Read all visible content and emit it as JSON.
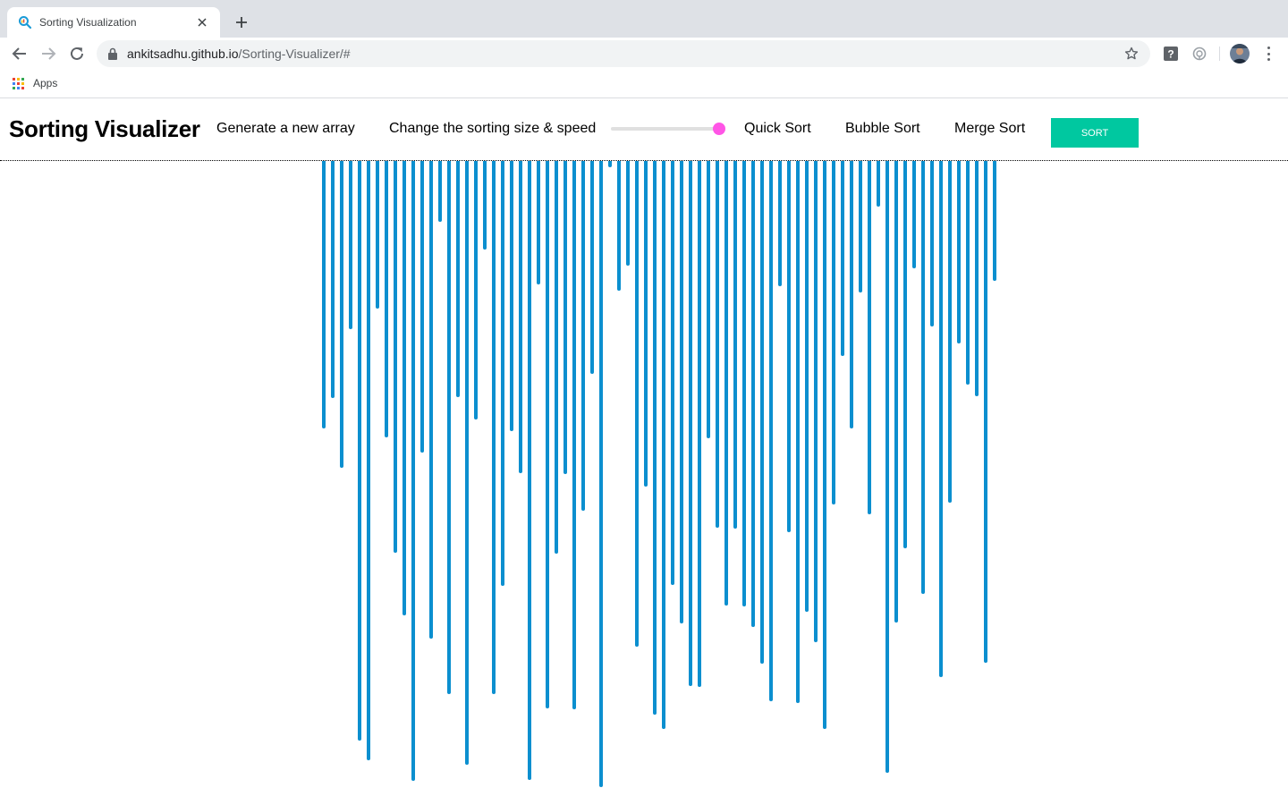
{
  "browser": {
    "tab_title": "Sorting Visualization",
    "url_host": "ankitsadhu.github.io",
    "url_path": "/Sorting-Visualizer/#",
    "bookmark_apps_label": "Apps"
  },
  "app": {
    "title": "Sorting Visualizer",
    "generate_label": "Generate a new array",
    "size_speed_label": "Change the sorting size & speed",
    "slider_value_percent": 100,
    "algorithms": [
      "Quick Sort",
      "Bubble Sort",
      "Merge Sort"
    ],
    "sort_button_label": "SORT"
  },
  "array_values": [
    299,
    265,
    343,
    188,
    648,
    670,
    165,
    309,
    438,
    508,
    693,
    326,
    534,
    68,
    596,
    264,
    675,
    289,
    99,
    596,
    475,
    302,
    349,
    692,
    138,
    612,
    439,
    350,
    613,
    391,
    238,
    700,
    7,
    145,
    117,
    543,
    364,
    619,
    635,
    474,
    517,
    587,
    588,
    310,
    410,
    497,
    411,
    498,
    521,
    562,
    604,
    140,
    415,
    606,
    504,
    538,
    635,
    384,
    218,
    299,
    147,
    395,
    51,
    684,
    516,
    433,
    120,
    484,
    185,
    577,
    382,
    204,
    250,
    263,
    561,
    134
  ],
  "colors": {
    "bar": "#0b8fcf",
    "sort_button": "#00c8a0",
    "slider_thumb": "#ff55e6"
  }
}
